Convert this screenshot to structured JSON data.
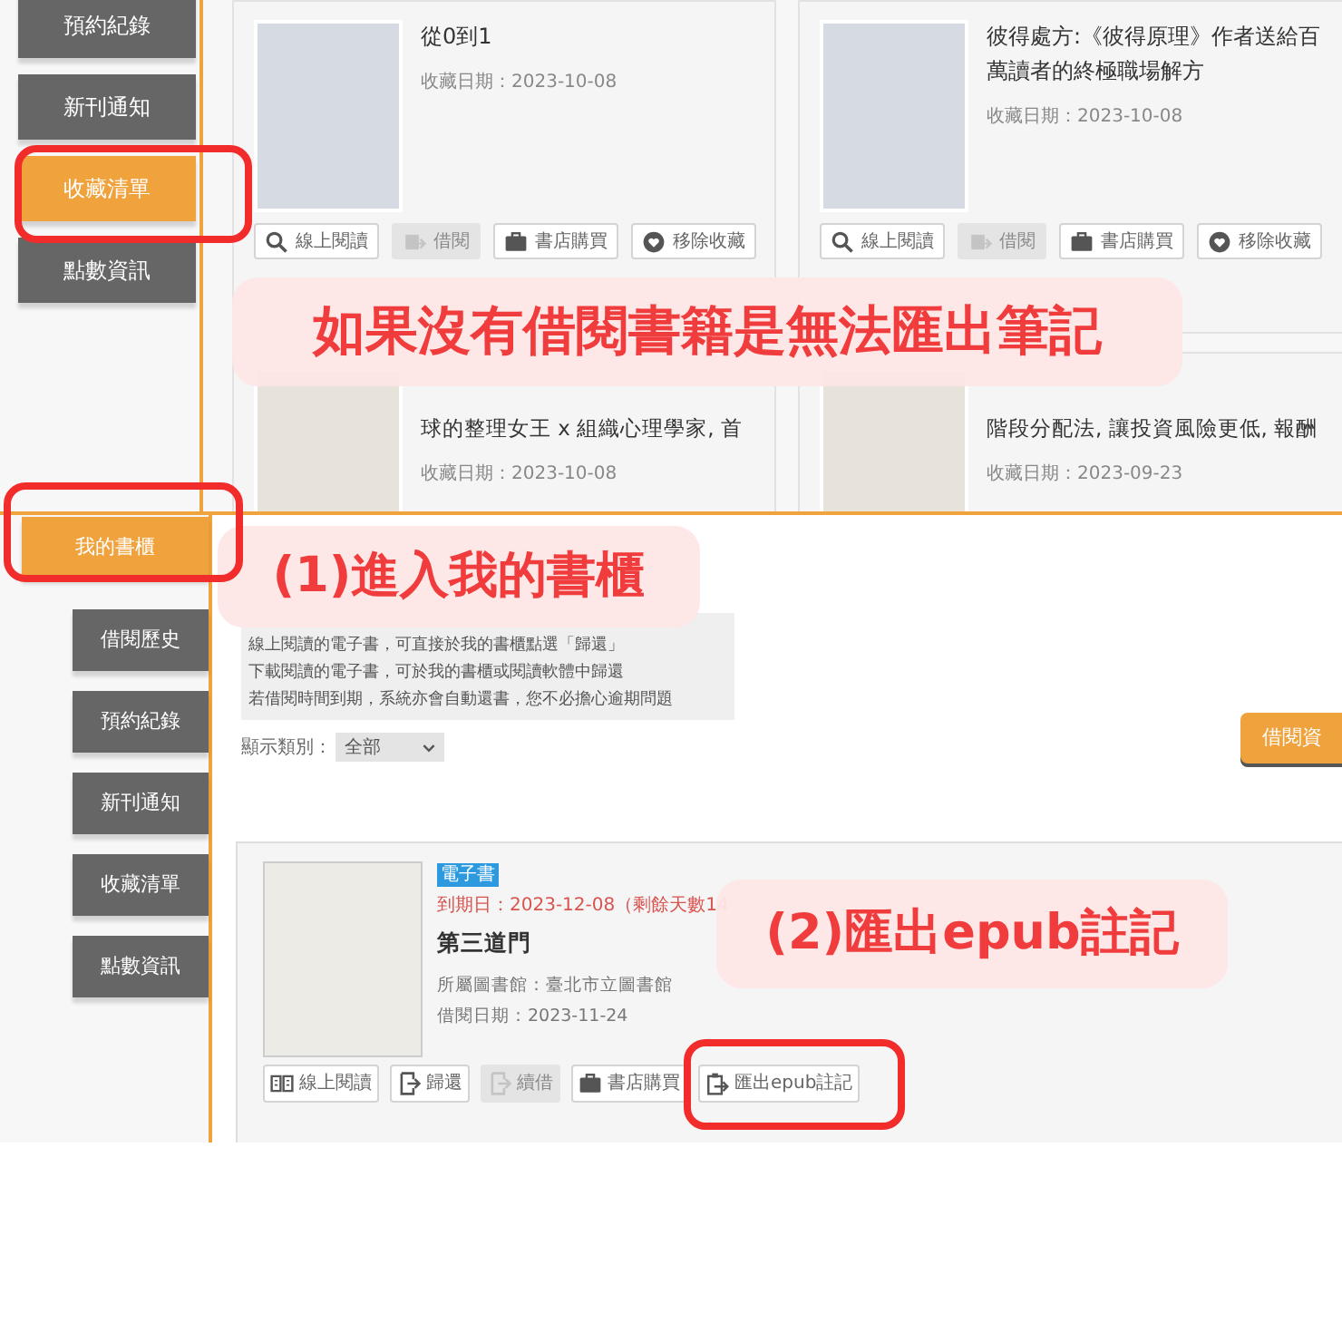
{
  "top_panel": {
    "sidebar": [
      {
        "label": "預約紀錄",
        "selected": false
      },
      {
        "label": "新刊通知",
        "selected": false
      },
      {
        "label": "收藏清單",
        "selected": true
      },
      {
        "label": "點數資訊",
        "selected": false
      }
    ],
    "books": [
      {
        "title": "從0到1",
        "date": "收藏日期：2023-10-08",
        "buttons": [
          {
            "kind": "search",
            "label": "線上閱讀",
            "disabled": false
          },
          {
            "kind": "borrow",
            "label": "借閱",
            "disabled": true
          },
          {
            "kind": "shop",
            "label": "書店購買",
            "disabled": false
          },
          {
            "kind": "heart",
            "label": "移除收藏",
            "disabled": false
          }
        ]
      },
      {
        "title": "彼得處方:《彼得原理》作者送給百萬讀者的終極職場解方",
        "date": "收藏日期：2023-10-08",
        "buttons": [
          {
            "kind": "search",
            "label": "線上閱讀",
            "disabled": false
          },
          {
            "kind": "borrow",
            "label": "借閱",
            "disabled": true
          },
          {
            "kind": "shop",
            "label": "書店購買",
            "disabled": false
          },
          {
            "kind": "heart",
            "label": "移除收藏",
            "disabled": false
          }
        ]
      },
      {
        "title": "球的整理女王 x 組織心理學家, 首",
        "date": "收藏日期：2023-10-08"
      },
      {
        "title": "階段分配法, 讓投資風險更低, 報酬",
        "date": "收藏日期：2023-09-23"
      }
    ]
  },
  "bottom_panel": {
    "sidebar": [
      {
        "label": "我的書櫃",
        "selected": true
      },
      {
        "label": "借閱歷史",
        "selected": false
      },
      {
        "label": "預約紀錄",
        "selected": false
      },
      {
        "label": "新刊通知",
        "selected": false
      },
      {
        "label": "收藏清單",
        "selected": false
      },
      {
        "label": "點數資訊",
        "selected": false
      }
    ],
    "notes": [
      "線上閱讀的電子書，可直接於我的書櫃點選「歸還」",
      "下載閱讀的電子書，可於我的書櫃或閱讀軟體中歸還",
      "若借閱時間到期，系統亦會自動還書，您不必擔心逾期問題"
    ],
    "filter": {
      "label": "顯示類別：",
      "value": "全部"
    },
    "info_button": "借閱資",
    "loan": {
      "tag": "電子書",
      "due": "到期日：2023-12-08（剩餘天數14",
      "title": "第三道門",
      "library": "所屬圖書館：臺北市立圖書館",
      "date": "借閱日期：2023-11-24",
      "buttons": [
        {
          "kind": "read",
          "label": "線上閱讀",
          "disabled": false
        },
        {
          "kind": "return",
          "label": "歸還",
          "disabled": false
        },
        {
          "kind": "renew",
          "label": "續借",
          "disabled": true
        },
        {
          "kind": "shop",
          "label": "書店購買",
          "disabled": false
        },
        {
          "kind": "export",
          "label": "匯出epub註記",
          "disabled": false
        }
      ]
    }
  },
  "callouts": [
    "如果沒有借閱書籍是無法匯出筆記",
    "(1)進入我的書櫃",
    "(2)匯出epub註記"
  ]
}
